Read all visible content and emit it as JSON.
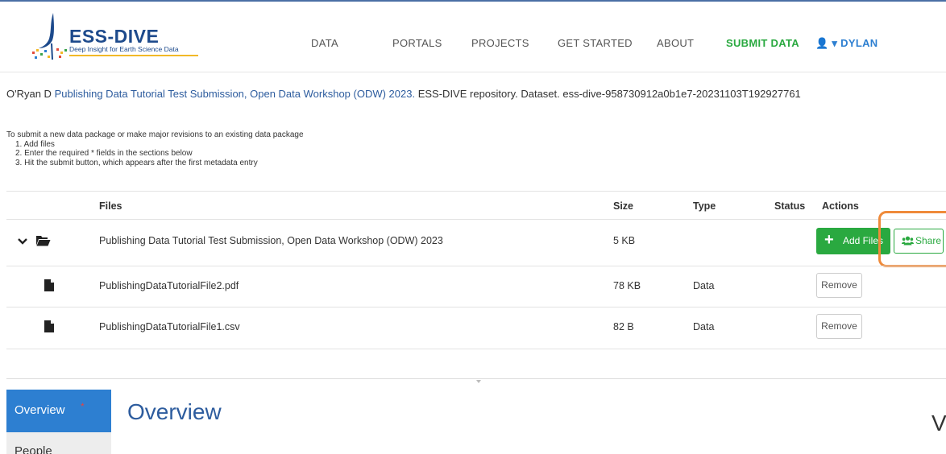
{
  "brand": {
    "name": "ESS-DIVE",
    "tagline": "Deep Insight for Earth Science Data"
  },
  "nav": {
    "items": [
      "DATA",
      "PORTALS",
      "PROJECTS",
      "GET STARTED",
      "ABOUT"
    ],
    "active": "SUBMIT DATA",
    "user": "DYLAN"
  },
  "citation": {
    "author": "O'Ryan D",
    "title": "Publishing Data Tutorial Test Submission, Open Data Workshop (ODW) 2023.",
    "rest": "ESS-DIVE repository. Dataset. ess-dive-958730912a0b1e7-20231103T192927761"
  },
  "instructions": {
    "intro": "To submit a new data package or make major revisions to an existing data package",
    "steps": [
      "1. Add files",
      "2. Enter the required * fields in the sections below",
      "3. Hit the submit button, which appears after the first metadata entry"
    ]
  },
  "table": {
    "headers": {
      "files": "Files",
      "size": "Size",
      "type": "Type",
      "status": "Status",
      "actions": "Actions"
    },
    "folder": {
      "name": "Publishing Data Tutorial Test Submission, Open Data Workshop (ODW) 2023",
      "size": "5 KB",
      "add_files_label": "Add Files",
      "share_label": "Share"
    },
    "files": [
      {
        "name": "PublishingDataTutorialFile2.pdf",
        "size": "78 KB",
        "type": "Data",
        "action": "Remove"
      },
      {
        "name": "PublishingDataTutorialFile1.csv",
        "size": "82 B",
        "type": "Data",
        "action": "Remove"
      }
    ]
  },
  "editor": {
    "tabs": [
      "Overview",
      "People"
    ],
    "required_marker": "*",
    "section_title": "Overview",
    "cut_letter": "V"
  },
  "colors": {
    "accent": "#2aa940",
    "link": "#2d5c9e",
    "tab_active": "#2d7fd1",
    "highlight": "#ef8a3a"
  }
}
